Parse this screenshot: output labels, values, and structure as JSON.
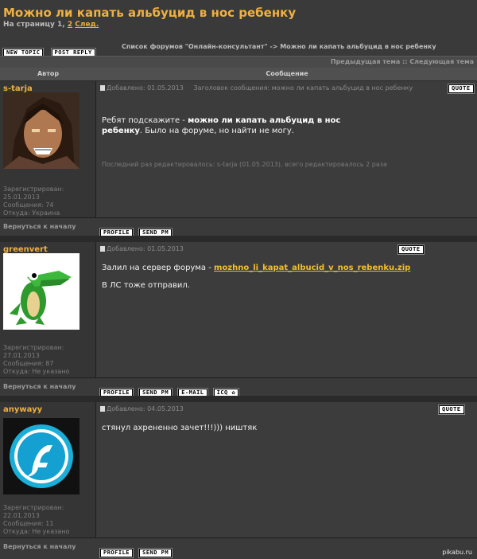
{
  "page": {
    "title": "Можно ли капать альбуцид в нос ребенку",
    "pages_prefix": "На страницу",
    "page_current": "1",
    "page_sep": ",",
    "page_link": "2",
    "page_next": "След."
  },
  "toolbar": {
    "new_topic": "NEW TOPIC",
    "post_reply": "POST REPLY",
    "breadcrumb": "Список форумов \"Онлайн-консультант\" -> Можно ли капать альбуцид в нос ребенку",
    "topic_nav": "Предыдущая тема :: Следующая тема"
  },
  "table": {
    "col_author": "Автор",
    "col_message": "Сообщение"
  },
  "posts": [
    {
      "author": "s-tarja",
      "added": "Добавлено: 01.05.2013",
      "subject": "Заголовок сообщения: можно ли капать альбуцид в нос ребенку",
      "quote": "QUOTE",
      "body_pre": "Ребят подскажите -",
      "body_bold": "можно ли капать альбуцид в нос ребенку",
      "body_post": ". Было на форуме, но найти не могу.",
      "edited": "Последний раз редактировалось: s-tarja (01.05.2013), всего редактировалось 2 раза",
      "reg_label": "Зарегистрирован:",
      "reg_date": "25.01.2013",
      "msgs": "Сообщения: 74",
      "from": "Откуда: Украина",
      "back": "Вернуться к началу",
      "btn_profile": "PROFILE",
      "btn_pm": "SEND PM"
    },
    {
      "author": "greenvert",
      "added": "Добавлено: 01.05.2013",
      "quote": "QUOTE",
      "body_pre": "Залил на сервер форума -",
      "body_link": "mozhno_li_kapat_albucid_v_nos_rebenku.zip",
      "body_line2": "В ЛС тоже отправил.",
      "reg_label": "Зарегистрирован:",
      "reg_date": "27.01.2013",
      "msgs": "Сообщения: 87",
      "from": "Откуда: Не указано",
      "back": "Вернуться к началу",
      "btn_profile": "PROFILE",
      "btn_pm": "SEND PM",
      "btn_email": "E-MAIL",
      "btn_icq": "ICQ"
    },
    {
      "author": "anywayy",
      "added": "Добавлено: 04.05.2013",
      "quote": "QUOTE",
      "body_pre": "стянул ахрененно зачет!!!))) ништяк",
      "reg_label": "Зарегистрирован:",
      "reg_date": "22.01.2013",
      "msgs": "Сообщения: 11",
      "from": "Откуда: Не указано",
      "back": "Вернуться к началу",
      "btn_profile": "PROFILE",
      "btn_pm": "SEND PM"
    }
  ],
  "watermark": "pikabu.ru",
  "colors": {
    "accent": "#f0b040",
    "link": "#f0c030",
    "bg": "#3a3a3a"
  }
}
